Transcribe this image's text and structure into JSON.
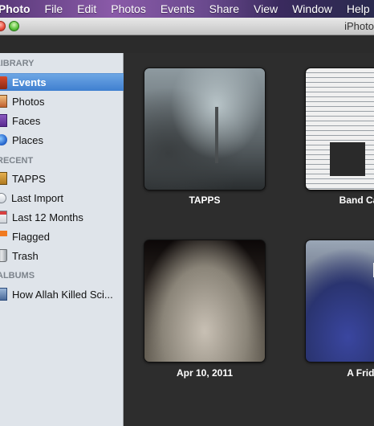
{
  "menubar": {
    "app_name": "iPhoto",
    "items": [
      "File",
      "Edit",
      "Photos",
      "Events",
      "Share",
      "View",
      "Window",
      "Help"
    ]
  },
  "window": {
    "title": "iPhoto"
  },
  "sidebar": {
    "sections": {
      "library": "LIBRARY",
      "recent": "RECENT",
      "albums": "ALBUMS"
    },
    "library_items": [
      {
        "label": "Events",
        "icon": "events-icon",
        "selected": true
      },
      {
        "label": "Photos",
        "icon": "photos-icon"
      },
      {
        "label": "Faces",
        "icon": "faces-icon"
      },
      {
        "label": "Places",
        "icon": "places-icon"
      }
    ],
    "recent_items": [
      {
        "label": "TAPPS",
        "icon": "event-icon"
      },
      {
        "label": "Last Import",
        "icon": "clock-icon"
      },
      {
        "label": "Last 12 Months",
        "icon": "calendar-icon"
      },
      {
        "label": "Flagged",
        "icon": "flag-icon"
      },
      {
        "label": "Trash",
        "icon": "trash-icon"
      }
    ],
    "album_items": [
      {
        "label": "How Allah Killed Sci...",
        "icon": "album-icon"
      }
    ]
  },
  "events": [
    {
      "label": "TAPPS"
    },
    {
      "label": "Band Camp"
    },
    {
      "label": "Apr 10, 2011"
    },
    {
      "label": "A Friday"
    }
  ],
  "colors": {
    "selection": "#3f7fd0",
    "sidebar_bg": "#dfe4ea",
    "content_bg": "#2d2d2d"
  }
}
